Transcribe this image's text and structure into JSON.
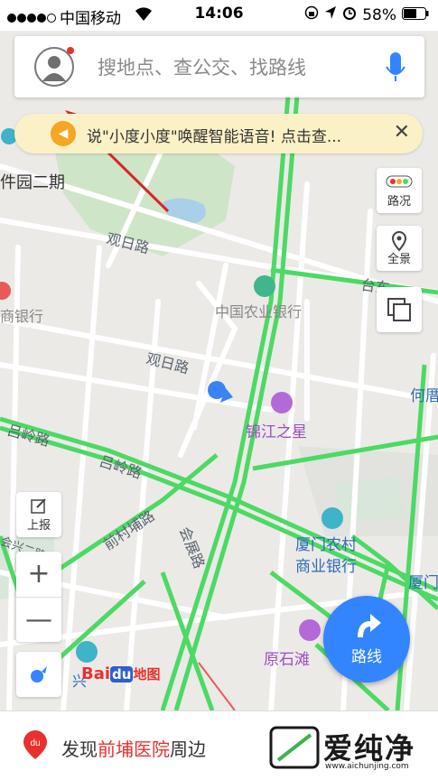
{
  "status_bar": {
    "carrier": "中国移动",
    "time": "14:06",
    "battery": "58%"
  },
  "search": {
    "placeholder": "搜地点、查公交、找路线"
  },
  "notice": {
    "text": "说\"小度小度\"唤醒智能语音! 点击查..."
  },
  "side_buttons": {
    "traffic": "路况",
    "panorama": "全景",
    "report": "上报"
  },
  "zoom": {
    "in": "+",
    "out": "—"
  },
  "route_button": "路线",
  "map_labels": {
    "park": "件园二期",
    "road1": "观日路",
    "road2": "观日路",
    "bank_left": "商银行",
    "agri_bank": "中国农业银行",
    "tai": "台东",
    "he": "何厝",
    "hotel": "锦江之星",
    "lvling1": "吕岭路",
    "lvling2": "吕岭路",
    "qiancun": "前村埔路",
    "huizhan": "会展路",
    "rural_bank_1": "厦门农村",
    "rural_bank_2": "商业银行",
    "xiamen": "厦门",
    "yuanshitan": "原石滩",
    "xing": "兴",
    "left_edge": "会兴二路"
  },
  "baidu_logo": {
    "bai": "Bai",
    "du": "du",
    "map": "地图"
  },
  "bottom": {
    "prefix": "发现",
    "highlight": "前埔医院",
    "suffix": "周边"
  },
  "watermark": {
    "brand": "爱纯净",
    "url": "www.aichunjing.com"
  },
  "colors": {
    "accent": "#3385ff",
    "road_green": "#4cd964",
    "highlight_red": "#e8312f",
    "notice_bg": "#fbf1c6"
  }
}
